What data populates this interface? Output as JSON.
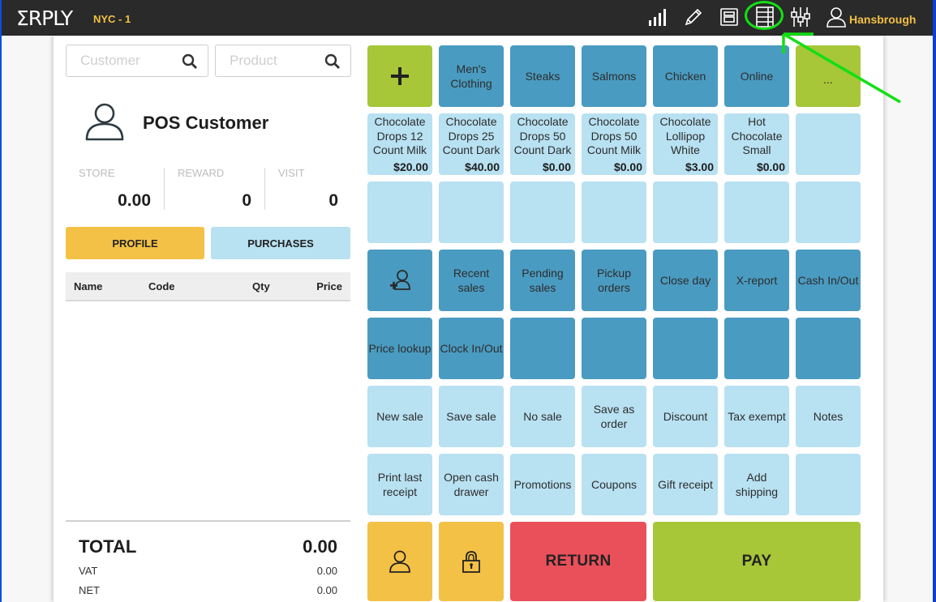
{
  "topbar": {
    "logo": "ΣRPLY",
    "store": "NYC - 1",
    "icons": [
      "signal-icon",
      "pencil-icon",
      "register-icon",
      "list-view-icon",
      "settings-sliders-icon"
    ],
    "user": "Hansbrough"
  },
  "left": {
    "customer_search_placeholder": "Customer",
    "product_search_placeholder": "Product",
    "customer_name": "POS Customer",
    "stats": [
      {
        "label": "STORE",
        "value": "0.00"
      },
      {
        "label": "REWARD",
        "value": "0"
      },
      {
        "label": "VISIT",
        "value": "0"
      }
    ],
    "tabs": {
      "profile": "PROFILE",
      "purchases": "PURCHASES"
    },
    "cart_columns": [
      "Name",
      "Code",
      "Qty",
      "Price"
    ],
    "cart_rows": [],
    "totals": {
      "total_label": "TOTAL",
      "total_value": "0.00",
      "vat_label": "VAT",
      "vat_value": "0.00",
      "net_label": "NET",
      "net_value": "0.00"
    }
  },
  "grid": {
    "add_symbol": "+",
    "categories": [
      "Men's Clothing",
      "Steaks",
      "Salmons",
      "Chicken",
      "Online"
    ],
    "more_label": "...",
    "products": [
      {
        "name": "Chocolate Drops 12 Count Milk",
        "price": "$20.00"
      },
      {
        "name": "Chocolate Drops 25 Count Dark",
        "price": "$40.00"
      },
      {
        "name": "Chocolate Drops 50 Count Dark",
        "price": "$0.00"
      },
      {
        "name": "Chocolate Drops 50 Count Milk",
        "price": "$0.00"
      },
      {
        "name": "Chocolate Lollipop White",
        "price": "$3.00"
      },
      {
        "name": "Hot Chocolate Small",
        "price": "$0.00"
      }
    ],
    "functions_row1": [
      "Recent sales",
      "Pending sales",
      "Pickup orders",
      "Close day",
      "X-report",
      "Cash In/Out"
    ],
    "functions_row2": [
      "Price lookup",
      "Clock In/Out"
    ],
    "actions_row1": [
      "New sale",
      "Save sale",
      "No sale",
      "Save as order",
      "Discount",
      "Tax exempt",
      "Notes"
    ],
    "actions_row2": [
      "Print last receipt",
      "Open cash drawer",
      "Promotions",
      "Coupons",
      "Gift receipt",
      "Add shipping"
    ],
    "return_label": "RETURN",
    "pay_label": "PAY"
  },
  "colors": {
    "topbar": "#2a2a2a",
    "accent_yellow": "#f3c145",
    "green": "#a7c638",
    "tile_dark": "#4a9bc1",
    "tile_light": "#b8e1f2",
    "return_red": "#ea505a",
    "annotation_green": "#12e012"
  }
}
